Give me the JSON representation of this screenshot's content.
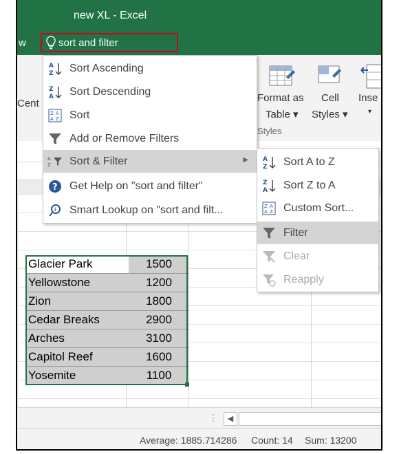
{
  "window": {
    "title": "new XL - Excel",
    "tab_fragment": "w"
  },
  "tell_me": {
    "query": "sort and filter"
  },
  "ribbon": {
    "left_fragment": "Cent",
    "format_as_table_line1": "Format as",
    "format_as_table_line2": "Table ▾",
    "cell_styles_line1": "Cell",
    "cell_styles_line2": "Styles ▾",
    "insert_fragment": "Inse",
    "styles_group": "Styles"
  },
  "main_menu": {
    "items": [
      {
        "label": "Sort Ascending",
        "icon": "sort-ascending-icon"
      },
      {
        "label": "Sort Descending",
        "icon": "sort-descending-icon"
      },
      {
        "label": "Sort",
        "icon": "sort-icon"
      },
      {
        "label": "Add or Remove Filters",
        "icon": "filter-icon"
      },
      {
        "label": "Sort & Filter",
        "icon": "sort-filter-icon"
      },
      {
        "label": "Get Help on \"sort and filter\"",
        "icon": "help-icon"
      },
      {
        "label": "Smart Lookup on \"sort and filt...",
        "icon": "smart-lookup-icon"
      }
    ]
  },
  "sub_menu": {
    "items": [
      {
        "label": "Sort A to Z",
        "icon": "sort-a-to-z-icon"
      },
      {
        "label": "Sort Z to A",
        "icon": "sort-z-to-a-icon"
      },
      {
        "label": "Custom Sort...",
        "icon": "custom-sort-icon"
      },
      {
        "label": "Filter",
        "icon": "filter-icon"
      },
      {
        "label": "Clear",
        "icon": "clear-filter-icon"
      },
      {
        "label": "Reapply",
        "icon": "reapply-icon"
      }
    ]
  },
  "data": {
    "rows": [
      {
        "name": "Glacier Park",
        "value": "1500"
      },
      {
        "name": "Yellowstone",
        "value": "1200"
      },
      {
        "name": "Zion",
        "value": "1800"
      },
      {
        "name": "Cedar Breaks",
        "value": "2900"
      },
      {
        "name": "Arches",
        "value": "3100"
      },
      {
        "name": "Capitol Reef",
        "value": "1600"
      },
      {
        "name": "Yosemite",
        "value": "1100"
      }
    ]
  },
  "status": {
    "average": "Average: 1885.714286",
    "count": "Count: 14",
    "sum": "Sum: 13200"
  },
  "colors": {
    "excel_green": "#217346",
    "highlight_red": "#d0021b",
    "menu_highlight": "#d4d4d4"
  }
}
